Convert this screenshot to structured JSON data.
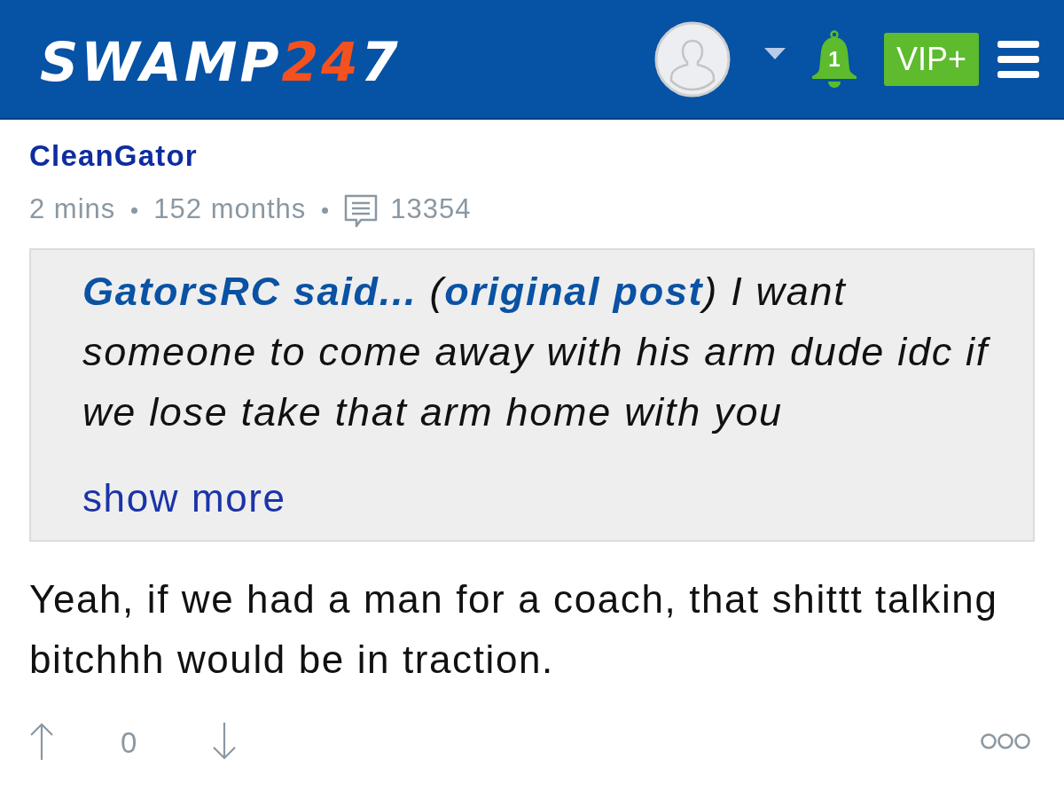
{
  "header": {
    "logo": [
      {
        "text": "SWAMP",
        "color": "#ffffff"
      },
      {
        "text": "24",
        "color": "#f4511e"
      },
      {
        "text": "7",
        "color": "#ffffff"
      }
    ],
    "notifications": {
      "count": "1"
    },
    "vip_button": {
      "label": "VIP+"
    }
  },
  "post": {
    "author": "CleanGator",
    "meta": {
      "time": "2 mins",
      "tenure": "152 months",
      "post_count": "13354"
    },
    "quote": {
      "author": "GatorsRC said...",
      "open": "(",
      "link": "original post",
      "close": ")",
      "text": "I want someone to come away with his arm dude idc if we lose take that arm home with you",
      "show_more": "show more"
    },
    "body": "Yeah, if we had a man for a coach, that shittt talking bitchhh would be in traction.",
    "votes": {
      "count": "0"
    }
  }
}
